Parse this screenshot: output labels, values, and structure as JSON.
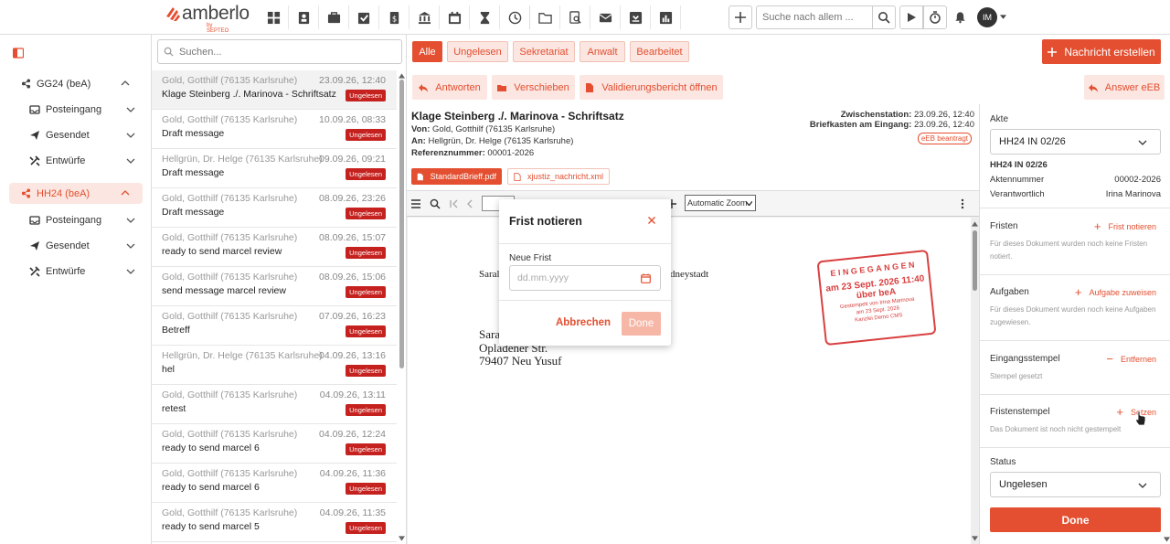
{
  "app": {
    "logo_text": "amberlo",
    "logo_sub": "by SEPTEO",
    "brand_color": "#e34f30",
    "search_placeholder": "Suche nach allem ...",
    "user_initials": "IM",
    "toolbar_icons": [
      "dashboard-icon",
      "contacts-icon",
      "briefcase-icon",
      "tasks-icon",
      "invoice-icon",
      "bank-icon",
      "calendar-icon",
      "hourglass-icon",
      "history-icon",
      "folder-icon",
      "document-search-icon",
      "mail-icon",
      "bea-inbox-icon",
      "reports-icon"
    ]
  },
  "sidebar": {
    "groups": [
      {
        "label": "GG24 (beA)",
        "items": [
          {
            "label": "Posteingang"
          },
          {
            "label": "Gesendet"
          },
          {
            "label": "Entwürfe"
          }
        ]
      },
      {
        "label": "HH24 (beA)",
        "items": [
          {
            "label": "Posteingang"
          },
          {
            "label": "Gesendet"
          },
          {
            "label": "Entwürfe"
          }
        ]
      }
    ]
  },
  "list": {
    "search_placeholder": "Suchen...",
    "messages": [
      {
        "from": "Gold, Gotthilf (76135 Karlsruhe)",
        "date": "23.09.26, 12:40",
        "subject": "Klage Steinberg ./. Marinova - Schriftsatz",
        "badge": "Ungelesen"
      },
      {
        "from": "Gold, Gotthilf (76135 Karlsruhe)",
        "date": "10.09.26, 08:33",
        "subject": "Draft message",
        "badge": "Ungelesen"
      },
      {
        "from": "Hellgrün, Dr. Helge (76135 Karlsruhe)",
        "date": "09.09.26, 09:21",
        "subject": "Draft message",
        "badge": "Ungelesen"
      },
      {
        "from": "Gold, Gotthilf (76135 Karlsruhe)",
        "date": "08.09.26, 23:26",
        "subject": "Draft message",
        "badge": "Ungelesen"
      },
      {
        "from": "Gold, Gotthilf (76135 Karlsruhe)",
        "date": "08.09.26, 15:07",
        "subject": "ready to send marcel review",
        "badge": "Ungelesen"
      },
      {
        "from": "Gold, Gotthilf (76135 Karlsruhe)",
        "date": "08.09.26, 15:06",
        "subject": "send message marcel review",
        "badge": "Ungelesen"
      },
      {
        "from": "Gold, Gotthilf (76135 Karlsruhe)",
        "date": "07.09.26, 16:23",
        "subject": "Betreff",
        "badge": "Ungelesen"
      },
      {
        "from": "Hellgrün, Dr. Helge (76135 Karlsruhe)",
        "date": "04.09.26, 13:16",
        "subject": "hel",
        "badge": "Ungelesen"
      },
      {
        "from": "Gold, Gotthilf (76135 Karlsruhe)",
        "date": "04.09.26, 13:11",
        "subject": "retest",
        "badge": "Ungelesen"
      },
      {
        "from": "Gold, Gotthilf (76135 Karlsruhe)",
        "date": "04.09.26, 12:24",
        "subject": "ready to send marcel 6",
        "badge": "Ungelesen"
      },
      {
        "from": "Gold, Gotthilf (76135 Karlsruhe)",
        "date": "04.09.26, 11:36",
        "subject": "ready to send marcel 6",
        "badge": "Ungelesen"
      },
      {
        "from": "Gold, Gotthilf (76135 Karlsruhe)",
        "date": "04.09.26, 11:35",
        "subject": "ready to send marcel 5",
        "badge": "Ungelesen"
      }
    ]
  },
  "filters": {
    "items": [
      "Alle",
      "Ungelesen",
      "Sekretariat",
      "Anwalt",
      "Bearbeitet"
    ],
    "new_message": "Nachricht erstellen"
  },
  "actions": {
    "reply": "Antworten",
    "move": "Verschieben",
    "validation": "Validierungsbericht öffnen",
    "answer_eeb": "Answer eEB"
  },
  "message": {
    "subject": "Klage Steinberg ./. Marinova - Schriftsatz",
    "from_label": "Von:",
    "from": "Gold, Gotthilf (76135 Karlsruhe)",
    "to_label": "An:",
    "to": "Hellgrün, Dr. Helge (76135 Karlsruhe)",
    "ref_label": "Referenznummer:",
    "ref": "00001-2026",
    "zw_label": "Zwischenstation:",
    "zw": "23.09.26, 12:40",
    "bk_label": "Briefkasten am Eingang:",
    "bk": "23.09.26, 12:40",
    "eeb_tag": "eEB beantragt",
    "attachments": [
      "StandardBrieff.pdf",
      "xjustiz_nachricht.xml"
    ]
  },
  "pdf": {
    "zoom": "Automatic Zoom",
    "line1_left": "Saral",
    "line1_right": "dneystadt",
    "addr1": "Sara",
    "addr2": "Opladener Str.",
    "addr3": "79407 Neu Yusuf",
    "stamp_title": "EINGEGANGEN",
    "stamp_date": "am 23 Sept. 2026 11:40",
    "stamp_via": "über beA",
    "stamp_small1": "Gestempelt von Irina Marinova",
    "stamp_small2": "am 23 Sept. 2026",
    "stamp_small3": "Kanzlei Demo CMS"
  },
  "modal": {
    "title": "Frist notieren",
    "label": "Neue Frist",
    "placeholder": "dd.mm.yyyy",
    "cancel": "Abbrechen",
    "done": "Done"
  },
  "details": {
    "akte_label": "Akte",
    "akte_value": "HH24 IN 02/26",
    "akte_title": "HH24 IN 02/26",
    "aktennummer_label": "Aktennummer",
    "aktennummer_value": "00002-2026",
    "verantwortlich_label": "Verantwortlich",
    "verantwortlich_value": "Irina Marinova",
    "fristen_label": "Fristen",
    "fristen_action": "Frist notieren",
    "fristen_info": "Für dieses Dokument wurden noch keine Fristen notiert.",
    "aufgaben_label": "Aufgaben",
    "aufgaben_action": "Aufgabe zuweisen",
    "aufgaben_info": "Für dieses Dokument wurden noch keine Aufgaben zugewiesen.",
    "eingang_label": "Eingangsstempel",
    "eingang_action": "Entfernen",
    "eingang_info": "Stempel gesetzt",
    "fristenstempel_label": "Fristenstempel",
    "fristenstempel_action": "Setzen",
    "fristenstempel_info": "Das Dokument ist noch nicht gestempelt",
    "status_label": "Status",
    "status_value": "Ungelesen",
    "done": "Done"
  }
}
